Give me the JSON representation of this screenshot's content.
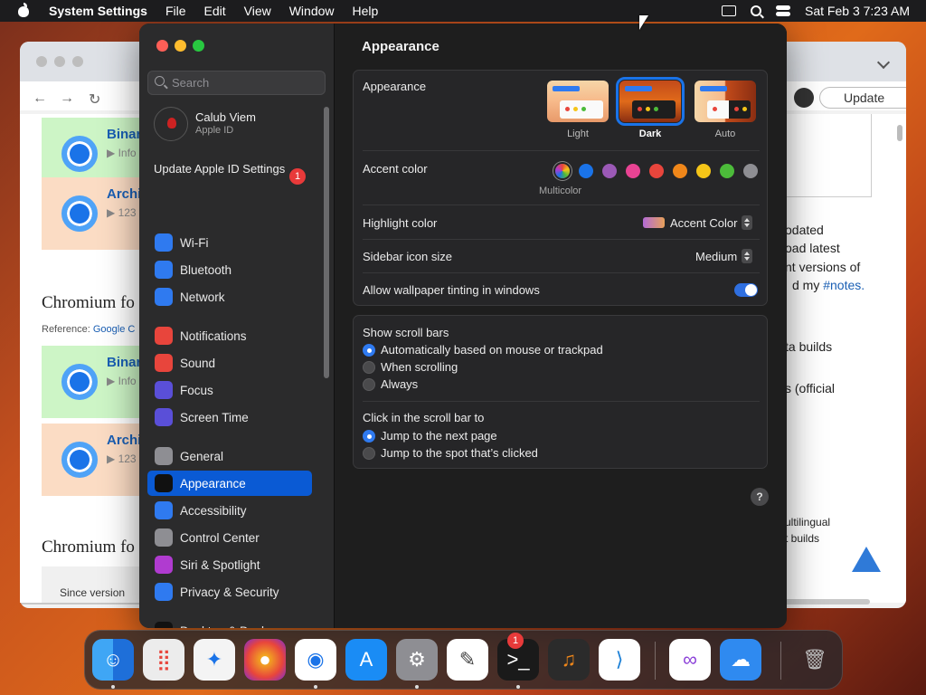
{
  "menubar": {
    "app": "System Settings",
    "items": [
      "File",
      "Edit",
      "View",
      "Window",
      "Help"
    ],
    "clock": "Sat Feb 3  7:23 AM"
  },
  "browser": {
    "update_label": "Update",
    "cards": [
      {
        "title": "Binar",
        "sub": "▶ Info"
      },
      {
        "title": "Archi",
        "sub": "▶ 123"
      },
      {
        "title": "Binar",
        "sub": "▶ Info"
      },
      {
        "title": "Archi",
        "sub": "▶ 123"
      }
    ],
    "section1": "Chromium fo",
    "reference_prefix": "Reference: ",
    "reference_link": "Google C",
    "section2": "Chromium fo",
    "since": "Since version",
    "right_lines": [
      "odated",
      "oad latest",
      "nt versions of",
      "d my ",
      "ta builds",
      "s (official",
      "ultilingual",
      "t builds"
    ],
    "notes_link": "#notes."
  },
  "settings": {
    "search_placeholder": "Search",
    "account_name": "Calub Viem",
    "account_sub": "Apple ID",
    "update_text": "Update Apple ID Settings",
    "update_badge": "1",
    "sidebar": [
      {
        "label": "Wi-Fi",
        "color": "#2f7af0",
        "icon": "wifi-icon"
      },
      {
        "label": "Bluetooth",
        "color": "#2f7af0",
        "icon": "bluetooth-icon"
      },
      {
        "label": "Network",
        "color": "#2f7af0",
        "icon": "network-icon"
      },
      {
        "label": "Notifications",
        "color": "#e8453c",
        "icon": "bell-icon"
      },
      {
        "label": "Sound",
        "color": "#e8453c",
        "icon": "speaker-icon"
      },
      {
        "label": "Focus",
        "color": "#5a4fd8",
        "icon": "moon-icon"
      },
      {
        "label": "Screen Time",
        "color": "#5a4fd8",
        "icon": "hourglass-icon"
      },
      {
        "label": "General",
        "color": "#8e8e93",
        "icon": "gear-icon"
      },
      {
        "label": "Appearance",
        "color": "#111111",
        "icon": "appearance-icon"
      },
      {
        "label": "Accessibility",
        "color": "#2f7af0",
        "icon": "accessibility-icon"
      },
      {
        "label": "Control Center",
        "color": "#8e8e93",
        "icon": "control-center-icon"
      },
      {
        "label": "Siri & Spotlight",
        "color": "#b03bd0",
        "icon": "siri-icon"
      },
      {
        "label": "Privacy & Security",
        "color": "#2f7af0",
        "icon": "hand-icon"
      },
      {
        "label": "Desktop & Dock",
        "color": "#111111",
        "icon": "dock-icon"
      }
    ],
    "active_item": "Appearance",
    "title": "Appearance",
    "appearance_label": "Appearance",
    "modes": [
      "Light",
      "Dark",
      "Auto"
    ],
    "selected_mode": "Dark",
    "accent_label": "Accent color",
    "accent_colors": [
      "#8e44ad",
      "#1a73e8",
      "#9b59b6",
      "#e84393",
      "#e8453c",
      "#f0871a",
      "#f5c518",
      "#4cbb3a",
      "#8e8e93"
    ],
    "accent_selected_name": "Multicolor",
    "highlight_label": "Highlight color",
    "highlight_value": "Accent Color",
    "icon_size_label": "Sidebar icon size",
    "icon_size_value": "Medium",
    "tinting_label": "Allow wallpaper tinting in windows",
    "tinting_on": true,
    "scroll_label": "Show scroll bars",
    "scroll_options": [
      "Automatically based on mouse or trackpad",
      "When scrolling",
      "Always"
    ],
    "scroll_selected": "Automatically based on mouse or trackpad",
    "click_label": "Click in the scroll bar to",
    "click_options": [
      "Jump to the next page",
      "Jump to the spot that’s clicked"
    ],
    "click_selected": "Jump to the next page",
    "help": "?"
  },
  "dock": {
    "apps": [
      "Finder",
      "Launchpad",
      "Safari",
      "Firefox",
      "Chrome",
      "App Store",
      "System Settings",
      "TextEdit",
      "Terminal",
      "GarageBand",
      "VS Code",
      "Visual Studio",
      "Weather",
      "Trash"
    ],
    "settings_badge": "1"
  }
}
